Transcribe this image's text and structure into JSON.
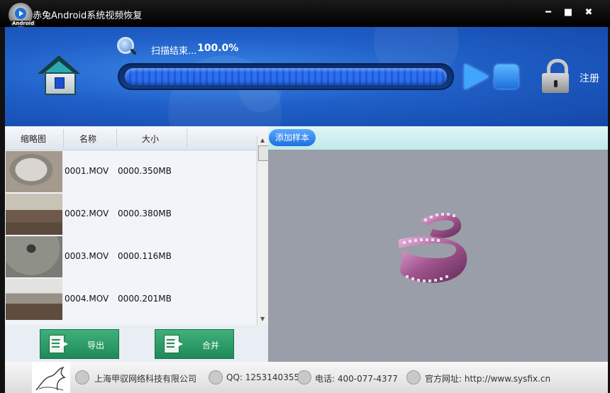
{
  "window": {
    "title": "赤兔Android系统视频恢复",
    "icon_badge": "Android",
    "controls": [
      "minimize",
      "maximize",
      "close"
    ]
  },
  "header": {
    "scan_status": "扫描结束...",
    "scan_percent": "100.0%",
    "progress": 1.0,
    "register_label": "注册",
    "icons": [
      "home-icon",
      "search-icon",
      "play-icon",
      "stop-icon",
      "lock-icon"
    ]
  },
  "file_list": {
    "columns": [
      "缩略图",
      "名称",
      "大小"
    ],
    "rows": [
      {
        "name": "0001.MOV",
        "size": "0000.350MB"
      },
      {
        "name": "0002.MOV",
        "size": "0000.380MB"
      },
      {
        "name": "0003.MOV",
        "size": "0000.116MB"
      },
      {
        "name": "0004.MOV",
        "size": "0000.201MB"
      }
    ]
  },
  "actions": {
    "export_label": "导出",
    "merge_label": "合并"
  },
  "preview": {
    "add_sample_label": "添加样本",
    "placeholder_icon": "film-reel-icon"
  },
  "footer": {
    "company": "上海甲驭网络科技有限公司",
    "qq": "QQ: 1253140355",
    "phone": "电话: 400-077-4377",
    "website": "官方网址: http://www.sysfix.cn"
  },
  "colors": {
    "header_blue": "#1f5fc7",
    "progress_blue": "#2a6ff0",
    "action_green": "#1f8a58",
    "preview_gray": "#9a9ea9",
    "film_purple": "#b06aa6"
  }
}
